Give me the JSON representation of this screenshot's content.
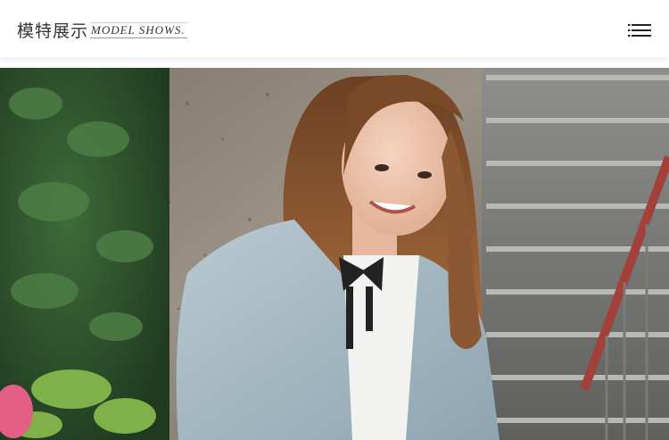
{
  "header": {
    "title_cn": "模特展示",
    "title_en": "MODEL SHOWS.",
    "menu_icon": "hamburger-menu-icon"
  },
  "hero": {
    "description": "model-photo"
  },
  "colors": {
    "header_bg": "#ffffff",
    "title_text": "#333333",
    "icon": "#222222"
  }
}
